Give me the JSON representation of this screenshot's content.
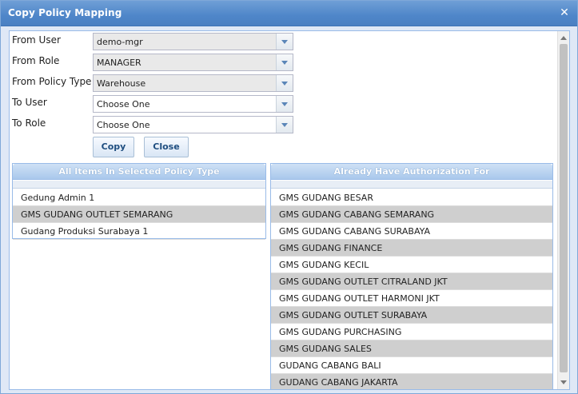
{
  "window": {
    "title": "Copy Policy Mapping",
    "close_icon": "close-icon"
  },
  "form": {
    "from_user": {
      "label": "From User",
      "value": "demo-mgr"
    },
    "from_role": {
      "label": "From Role",
      "value": "MANAGER"
    },
    "from_policy_type": {
      "label": "From Policy Type",
      "value": "Warehouse"
    },
    "to_user": {
      "label": "To User",
      "value": "Choose One"
    },
    "to_role": {
      "label": "To Role",
      "value": "Choose One"
    }
  },
  "buttons": {
    "copy": "Copy",
    "close": "Close"
  },
  "left_panel": {
    "title": "All Items In Selected Policy Type",
    "items": [
      "Gedung Admin 1",
      "GMS GUDANG OUTLET SEMARANG",
      "Gudang Produksi Surabaya 1"
    ]
  },
  "right_panel": {
    "title": "Already Have Authorization For",
    "items": [
      "GMS GUDANG BESAR",
      "GMS GUDANG CABANG SEMARANG",
      "GMS GUDANG CABANG SURABAYA",
      "GMS GUDANG FINANCE",
      "GMS GUDANG KECIL",
      "GMS GUDANG OUTLET CITRALAND JKT",
      "GMS GUDANG OUTLET HARMONI JKT",
      "GMS GUDANG OUTLET SURABAYA",
      "GMS GUDANG PURCHASING",
      "GMS GUDANG SALES",
      "GUDANG CABANG BALI",
      "GUDANG CABANG JAKARTA"
    ]
  },
  "colors": {
    "title_bar": "#4f86c9",
    "panel_header": "#a9c8ec",
    "alt_row": "#cfcfcf"
  }
}
